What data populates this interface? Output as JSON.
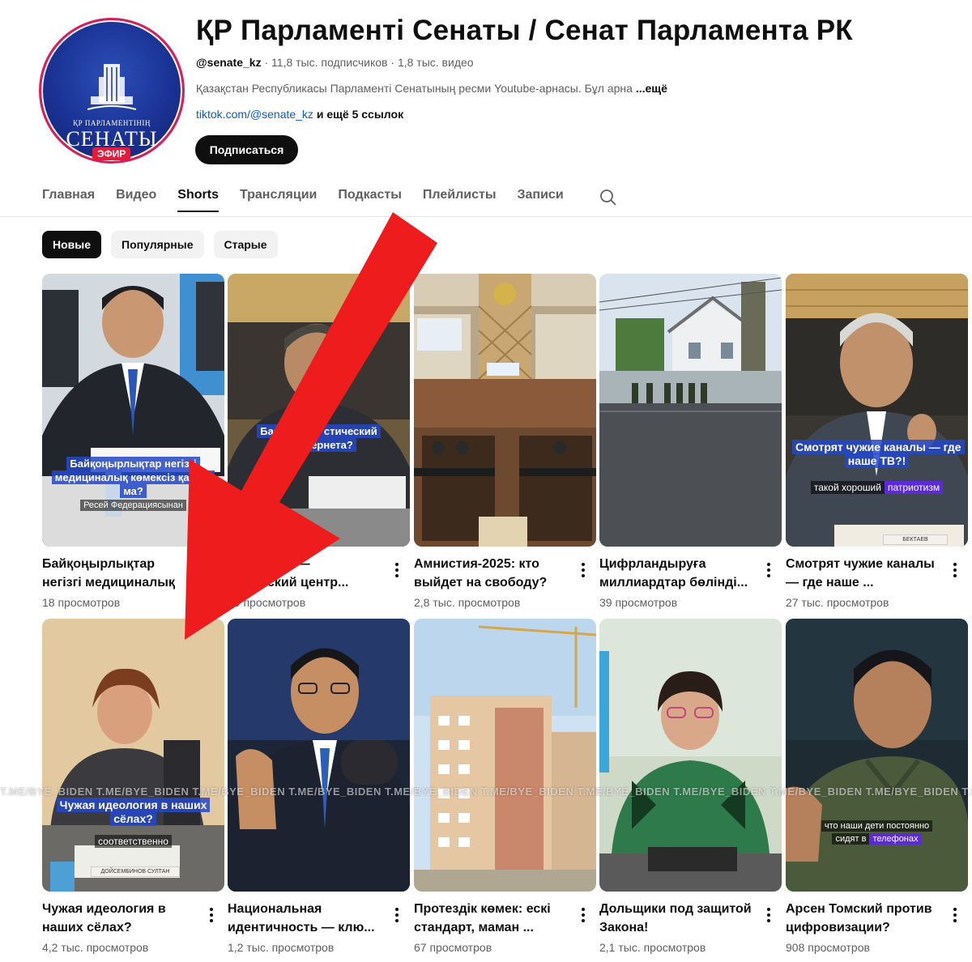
{
  "channel": {
    "avatar_text_line1": "ҚР ПАРЛАМЕНТІНІҢ",
    "avatar_text_line2": "СЕНАТЫ",
    "live_badge": "ЭФИР",
    "title": "ҚР Парламенті Сенаты / Сенат Парламента РК",
    "handle": "@senate_kz",
    "subscribers": "11,8 тыс. подписчиков",
    "videos": "1,8 тыс. видео",
    "description": "Қазақстан Республикасы Парламенті Сенатының ресми Youtube-арнасы. Бұл арна",
    "description_more": "...ещё",
    "link": "tiktok.com/@senate_kz",
    "link_more": "и ещё 5 ссылок",
    "subscribe_label": "Подписаться"
  },
  "tabs": [
    {
      "label": "Главная"
    },
    {
      "label": "Видео"
    },
    {
      "label": "Shorts"
    },
    {
      "label": "Трансляции"
    },
    {
      "label": "Подкасты"
    },
    {
      "label": "Плейлисты"
    },
    {
      "label": "Записи"
    }
  ],
  "active_tab": "Shorts",
  "chips": [
    {
      "label": "Новые"
    },
    {
      "label": "Популярные"
    },
    {
      "label": "Старые"
    }
  ],
  "shorts": [
    {
      "title": "Байқоңырлықтар негізгі медициналық көмексіз қалды ма?",
      "title_visible": "Байқоңырлықтар негі... медициналық ...",
      "views": "18 просмотров",
      "overlay": "Байқоңырлықтар негізгі медициналық көмексіз қалды ма?",
      "overlay_sub": "Ресей Федерациясынан"
    },
    {
      "title": "Байқоңыр — ...тический центр...",
      "views": "69 просмотров",
      "overlay": "Баяндама... стический ...интернета?"
    },
    {
      "title": "Амнистия-2025: кто выйдет на свободу?",
      "views": "2,8 тыс. просмотров"
    },
    {
      "title": "Цифрландыруға миллиардтар бөлінді...",
      "views": "39 просмотров"
    },
    {
      "title": "Смотрят чужие каналы — где наше ...",
      "views": "27 тыс. просмотров",
      "overlay": "Смотрят чужие каналы — где наше ТВ?!",
      "overlay_sub_a": "такой хороший",
      "overlay_sub_b": "патриотизм",
      "nameplate": "БЕКТАЕВ"
    },
    {
      "title": "Чужая идеология в наших сёлах?",
      "views": "4,2 тыс. просмотров",
      "overlay": "Чужая идеология в наших сёлах?",
      "overlay_sub": "соответственно",
      "nameplate": "ДОЙСЕМБИНОВ СУЛТАН"
    },
    {
      "title": "Национальная идентичность — клю...",
      "views": "1,2 тыс. просмотров"
    },
    {
      "title": "Протездік көмек: ескі стандарт, маман ...",
      "views": "67 просмотров"
    },
    {
      "title": "Дольщики под защитой Закона!",
      "views": "2,1 тыс. просмотров"
    },
    {
      "title": "Арсен Томский против цифровизации?",
      "views": "908 просмотров",
      "overlay_sub_a": "что наши дети постоянно",
      "overlay_sub_b": "сидят в",
      "overlay_sub_c": "телефонах"
    }
  ],
  "watermark": "T.ME/BYE_BIDEN T.ME/BYE_BIDEN T.ME/BYE_BIDEN T.ME/BYE_BIDEN T.ME/BYE_BIDEN T.ME/BYE_BIDEN T.ME/BYE_BIDEN T.ME/BYE_BIDEN T.ME/BYE_BIDEN T.ME/BYE_BIDEN T.ME/BYE_BIDEN T.ME/BYE_BIDEN",
  "colors": {
    "accent_red_arrow": "#ee1c1c",
    "subscribe_bg": "#0f0f0f",
    "link": "#065fd4",
    "overlay_blue": "#2448c8",
    "avatar_blue": "#1a3294"
  },
  "icons": {
    "search": "search-icon",
    "more": "kebab-menu-icon",
    "annotation": "red-arrow-icon"
  }
}
